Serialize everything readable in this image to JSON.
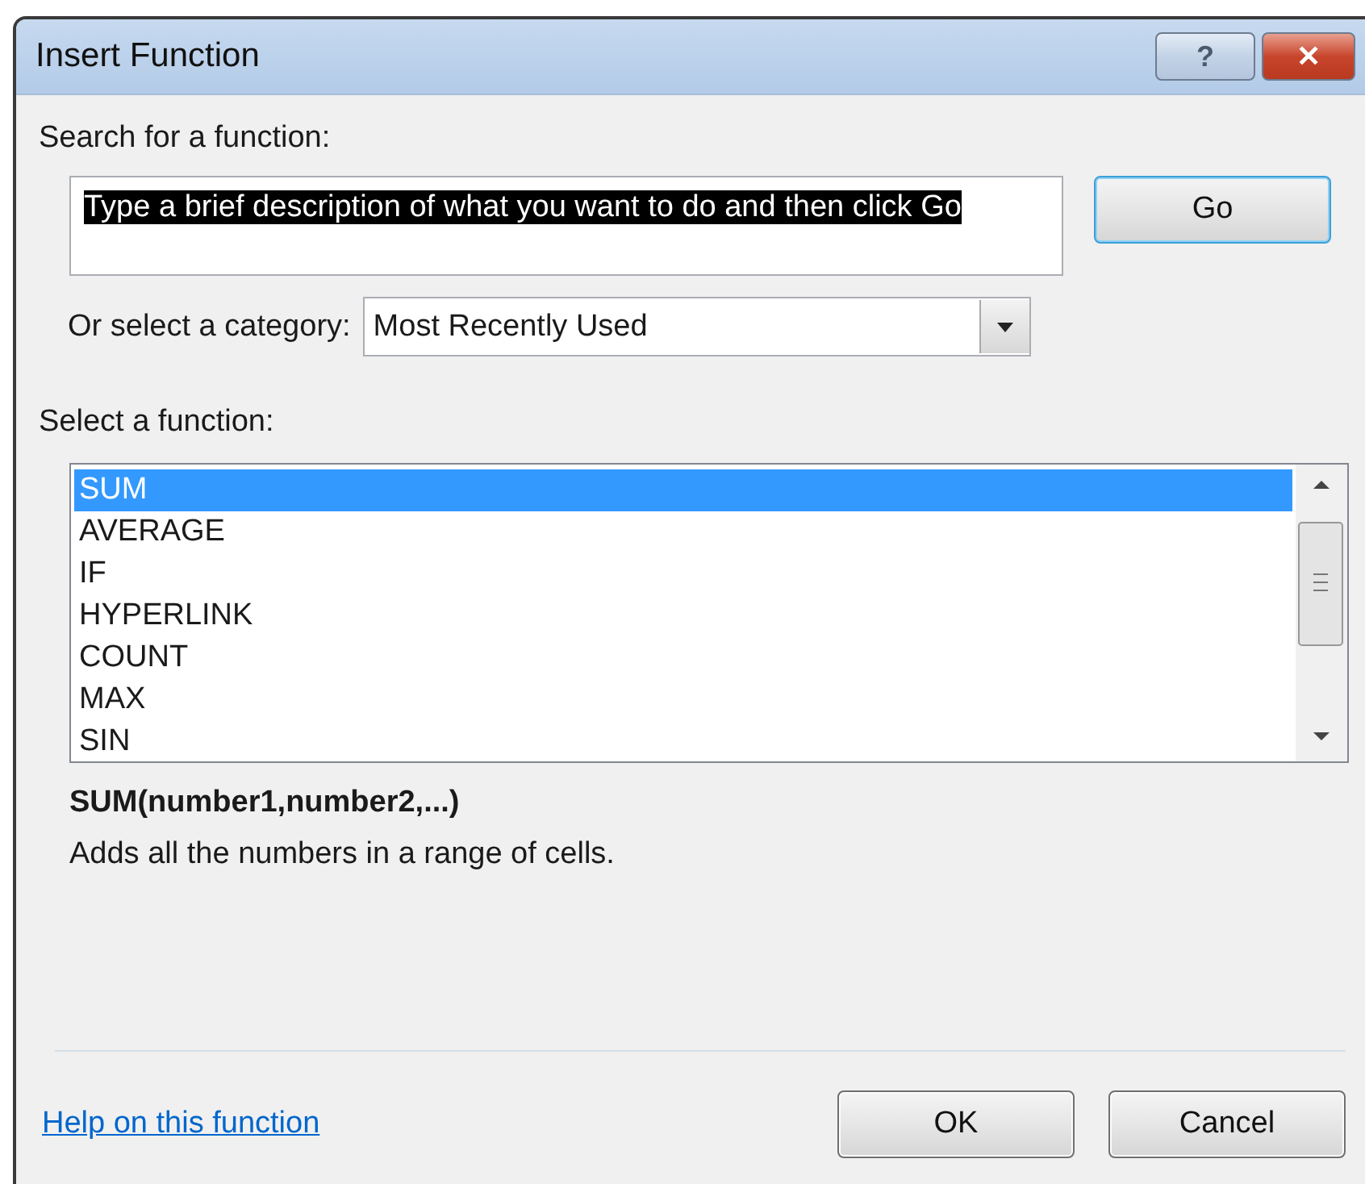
{
  "window": {
    "title": "Insert Function",
    "buttons": [
      {
        "kind": "help",
        "label": "?"
      },
      {
        "kind": "close",
        "label": "✕"
      }
    ]
  },
  "search": {
    "label": "Search for a function:",
    "value": "Type a brief description of what you want to do and then click Go",
    "value_selected": true,
    "button": "Go"
  },
  "category": {
    "label": "Or select a category:",
    "value": "Most Recently Used"
  },
  "functions": {
    "label": "Select a function:",
    "items": [
      {
        "name": "SUM",
        "selected": true
      },
      {
        "name": "AVERAGE",
        "selected": false
      },
      {
        "name": "IF",
        "selected": false
      },
      {
        "name": "HYPERLINK",
        "selected": false
      },
      {
        "name": "COUNT",
        "selected": false
      },
      {
        "name": "MAX",
        "selected": false
      },
      {
        "name": "SIN",
        "selected": false
      }
    ]
  },
  "signature": "SUM(number1,number2,...)",
  "description": "Adds all the numbers in a range of cells.",
  "help_link": "Help on this function",
  "buttons": [
    "OK",
    "Cancel"
  ]
}
